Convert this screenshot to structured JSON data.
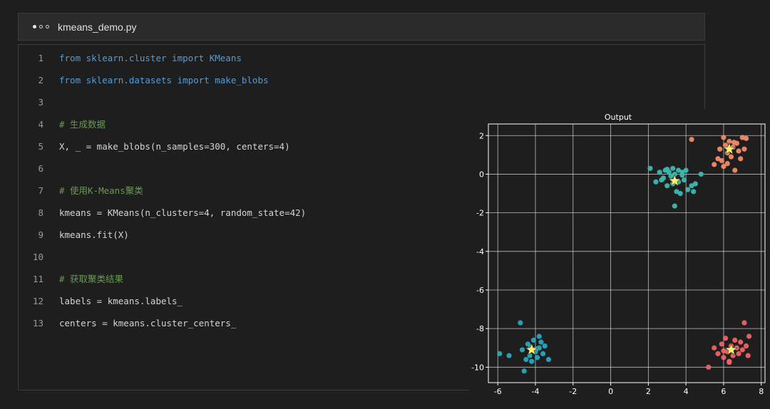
{
  "window": {
    "filename": "kmeans_demo.py"
  },
  "editor": {
    "lines": [
      {
        "num": "1",
        "text": "from sklearn.cluster import KMeans",
        "kind": "kw"
      },
      {
        "num": "2",
        "text": "from sklearn.datasets import make_blobs",
        "kind": "kw"
      },
      {
        "num": "3",
        "text": "",
        "kind": "pl"
      },
      {
        "num": "4",
        "text": "# 生成数据",
        "kind": "cm"
      },
      {
        "num": "5",
        "text": "X, _ = make_blobs(n_samples=300, centers=4)",
        "kind": "pl"
      },
      {
        "num": "6",
        "text": "",
        "kind": "pl"
      },
      {
        "num": "7",
        "text": "# 使用K-Means聚类",
        "kind": "cm"
      },
      {
        "num": "8",
        "text": "kmeans = KMeans(n_clusters=4, random_state=42)",
        "kind": "pl"
      },
      {
        "num": "9",
        "text": "kmeans.fit(X)",
        "kind": "pl"
      },
      {
        "num": "10",
        "text": "",
        "kind": "pl"
      },
      {
        "num": "11",
        "text": "# 获取聚类结果",
        "kind": "cm"
      },
      {
        "num": "12",
        "text": "labels = kmeans.labels_",
        "kind": "pl"
      },
      {
        "num": "13",
        "text": "centers = kmeans.cluster_centers_",
        "kind": "pl"
      }
    ]
  },
  "chart_data": {
    "type": "scatter",
    "title": "Output",
    "xlabel": "",
    "ylabel": "",
    "xlim": [
      -6.5,
      8.2
    ],
    "ylim": [
      -10.8,
      2.6
    ],
    "xticks": [
      -6,
      -4,
      -2,
      0,
      2,
      4,
      6,
      8
    ],
    "yticks": [
      2,
      0,
      -2,
      -4,
      -6,
      -8,
      -10
    ],
    "grid": true,
    "series": [
      {
        "color": "#3cb8b0",
        "points": [
          [
            2.1,
            0.3
          ],
          [
            2.4,
            -0.4
          ],
          [
            2.6,
            0.1
          ],
          [
            2.8,
            -0.2
          ],
          [
            2.9,
            0.2
          ],
          [
            3.0,
            -0.6
          ],
          [
            3.1,
            0.1
          ],
          [
            3.2,
            -0.1
          ],
          [
            3.3,
            0.3
          ],
          [
            3.3,
            -0.5
          ],
          [
            3.4,
            0.0
          ],
          [
            3.5,
            -0.9
          ],
          [
            3.6,
            0.2
          ],
          [
            3.6,
            -0.4
          ],
          [
            3.7,
            -1.0
          ],
          [
            3.8,
            0.1
          ],
          [
            3.9,
            -0.3
          ],
          [
            4.0,
            0.2
          ],
          [
            4.1,
            -0.8
          ],
          [
            4.3,
            -0.6
          ],
          [
            4.4,
            -0.9
          ],
          [
            4.5,
            -0.5
          ],
          [
            4.8,
            0.0
          ],
          [
            3.4,
            -1.65
          ],
          [
            2.7,
            -0.3
          ],
          [
            3.0,
            0.25
          ],
          [
            3.8,
            -0.05
          ]
        ]
      },
      {
        "color": "#f28a68",
        "points": [
          [
            4.3,
            1.8
          ],
          [
            5.5,
            0.5
          ],
          [
            5.8,
            1.3
          ],
          [
            5.9,
            0.7
          ],
          [
            6.0,
            1.9
          ],
          [
            6.0,
            0.4
          ],
          [
            6.1,
            1.5
          ],
          [
            6.2,
            1.1
          ],
          [
            6.3,
            1.7
          ],
          [
            6.4,
            0.9
          ],
          [
            6.5,
            1.4
          ],
          [
            6.6,
            0.2
          ],
          [
            6.7,
            1.6
          ],
          [
            6.8,
            1.2
          ],
          [
            6.9,
            0.8
          ],
          [
            7.0,
            1.9
          ],
          [
            7.1,
            1.3
          ],
          [
            7.2,
            1.85
          ],
          [
            6.2,
            0.55
          ],
          [
            6.55,
            1.65
          ],
          [
            5.7,
            0.8
          ]
        ]
      },
      {
        "color": "#28a7bd",
        "points": [
          [
            -5.9,
            -9.3
          ],
          [
            -5.4,
            -9.4
          ],
          [
            -4.8,
            -7.7
          ],
          [
            -4.7,
            -9.1
          ],
          [
            -4.6,
            -10.2
          ],
          [
            -4.5,
            -9.6
          ],
          [
            -4.4,
            -8.8
          ],
          [
            -4.3,
            -9.4
          ],
          [
            -4.2,
            -9.7
          ],
          [
            -4.1,
            -8.6
          ],
          [
            -4.0,
            -9.2
          ],
          [
            -3.9,
            -9.5
          ],
          [
            -3.8,
            -8.4
          ],
          [
            -3.8,
            -9.0
          ],
          [
            -3.7,
            -8.7
          ],
          [
            -3.6,
            -9.3
          ],
          [
            -3.5,
            -8.9
          ],
          [
            -3.3,
            -9.6
          ],
          [
            -4.25,
            -8.95
          ],
          [
            -3.95,
            -9.05
          ]
        ]
      },
      {
        "color": "#f06265",
        "points": [
          [
            5.2,
            -10.0
          ],
          [
            5.5,
            -9.0
          ],
          [
            5.7,
            -9.3
          ],
          [
            5.9,
            -8.8
          ],
          [
            6.0,
            -9.5
          ],
          [
            6.1,
            -8.5
          ],
          [
            6.2,
            -9.2
          ],
          [
            6.3,
            -9.7
          ],
          [
            6.4,
            -8.9
          ],
          [
            6.5,
            -9.4
          ],
          [
            6.6,
            -8.6
          ],
          [
            6.7,
            -9.0
          ],
          [
            6.8,
            -9.3
          ],
          [
            6.9,
            -8.7
          ],
          [
            7.0,
            -9.1
          ],
          [
            7.1,
            -7.7
          ],
          [
            7.2,
            -8.9
          ],
          [
            7.3,
            -9.4
          ],
          [
            7.35,
            -8.4
          ],
          [
            6.3,
            -9.75
          ],
          [
            6.0,
            -9.15
          ]
        ]
      }
    ],
    "centers": [
      [
        3.4,
        -0.35
      ],
      [
        6.3,
        1.3
      ],
      [
        -4.2,
        -9.1
      ],
      [
        6.4,
        -9.1
      ]
    ],
    "center_color": "#fff06a"
  }
}
